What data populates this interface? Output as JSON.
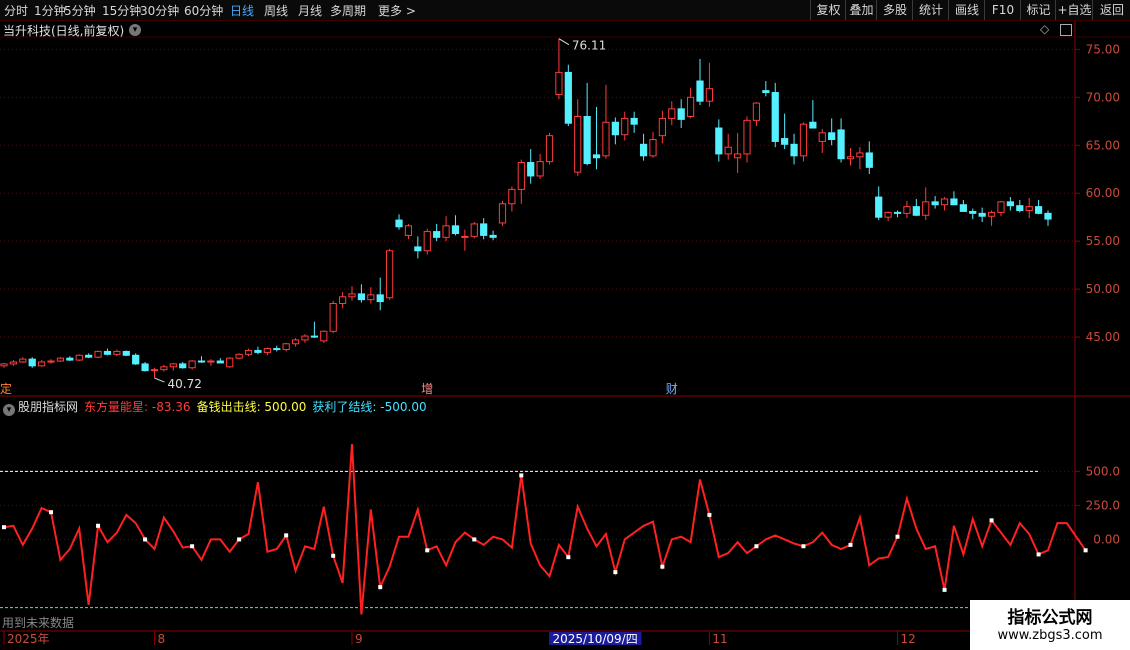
{
  "toolbar": {
    "periods": [
      "分时",
      "1分钟",
      "5分钟",
      "15分钟",
      "30分钟",
      "60分钟",
      "日线",
      "周线",
      "月线",
      "多周期",
      "更多 >"
    ],
    "active_index": 6,
    "right_buttons": [
      "复权",
      "叠加",
      "多股",
      "统计",
      "画线",
      "F10",
      "标记",
      "+自选",
      "返回"
    ]
  },
  "stock": {
    "title": "当升科技(日线,前复权)"
  },
  "indicator": {
    "source": "股朋指标网",
    "legend": [
      {
        "label": "东方量能星: -83.36",
        "color": "#ff3b3b"
      },
      {
        "label": "备钱出击线: 500.00",
        "color": "#ffff40"
      },
      {
        "label": "获利了结线: -500.00",
        "color": "#40e0ff"
      }
    ],
    "note": "用到未来数据"
  },
  "brand": {
    "name": "指标公式网",
    "url": "www.zbgs3.com"
  },
  "colors": {
    "up": "#ff3b3b",
    "down": "#54f0ff",
    "grid": "#6a0000",
    "axis_text": "#c84b3a"
  },
  "chart_data": [
    {
      "type": "candlestick",
      "y_ticks": [
        "45.00",
        "50.00",
        "55.00",
        "60.00",
        "65.00",
        "70.00",
        "75.00"
      ],
      "ylim": [
        40.0,
        76.5
      ],
      "annotations": [
        {
          "text": "76.11",
          "index": 59,
          "value": 76.11
        },
        {
          "text": "40.72",
          "index": 16,
          "value": 40.72
        }
      ],
      "event_markers": [
        {
          "text": "定",
          "index": 0
        },
        {
          "text": "增",
          "index": 45
        },
        {
          "text": "财",
          "index": 71
        }
      ],
      "ohlc": [
        [
          42.0,
          42.3,
          41.8,
          42.2
        ],
        [
          42.2,
          42.6,
          42.0,
          42.4
        ],
        [
          42.4,
          42.9,
          42.3,
          42.7
        ],
        [
          42.7,
          42.9,
          41.8,
          42.0
        ],
        [
          42.0,
          42.6,
          41.9,
          42.4
        ],
        [
          42.4,
          42.7,
          42.2,
          42.5
        ],
        [
          42.5,
          42.9,
          42.4,
          42.8
        ],
        [
          42.8,
          43.0,
          42.5,
          42.6
        ],
        [
          42.6,
          43.2,
          42.5,
          43.1
        ],
        [
          43.1,
          43.3,
          42.8,
          42.9
        ],
        [
          42.9,
          43.6,
          42.8,
          43.5
        ],
        [
          43.5,
          43.8,
          43.1,
          43.2
        ],
        [
          43.2,
          43.7,
          43.0,
          43.5
        ],
        [
          43.5,
          43.6,
          43.0,
          43.1
        ],
        [
          43.1,
          43.3,
          42.1,
          42.2
        ],
        [
          42.2,
          42.4,
          41.4,
          41.5
        ],
        [
          41.5,
          41.8,
          40.72,
          41.6
        ],
        [
          41.6,
          42.1,
          41.4,
          41.9
        ],
        [
          41.9,
          42.3,
          41.5,
          42.2
        ],
        [
          42.2,
          42.4,
          41.7,
          41.8
        ],
        [
          41.8,
          42.6,
          41.6,
          42.5
        ],
        [
          42.5,
          43.0,
          42.3,
          42.4
        ],
        [
          42.4,
          42.7,
          42.0,
          42.5
        ],
        [
          42.5,
          42.8,
          42.3,
          42.3
        ],
        [
          41.9,
          42.9,
          41.8,
          42.8
        ],
        [
          42.8,
          43.3,
          42.7,
          43.2
        ],
        [
          43.2,
          43.8,
          43.0,
          43.6
        ],
        [
          43.6,
          44.0,
          43.2,
          43.4
        ],
        [
          43.4,
          43.9,
          43.1,
          43.8
        ],
        [
          43.8,
          44.1,
          43.5,
          43.7
        ],
        [
          43.7,
          44.4,
          43.5,
          44.3
        ],
        [
          44.3,
          44.9,
          44.0,
          44.7
        ],
        [
          44.7,
          45.3,
          44.4,
          45.1
        ],
        [
          45.1,
          46.6,
          44.9,
          45.0
        ],
        [
          44.6,
          45.7,
          44.4,
          45.6
        ],
        [
          45.6,
          48.8,
          45.4,
          48.5
        ],
        [
          48.5,
          49.7,
          48.0,
          49.2
        ],
        [
          49.2,
          50.3,
          48.8,
          49.5
        ],
        [
          49.5,
          50.5,
          48.6,
          48.9
        ],
        [
          48.9,
          50.2,
          48.5,
          49.4
        ],
        [
          49.4,
          51.2,
          47.8,
          48.7
        ],
        [
          49.1,
          54.2,
          48.9,
          54.0
        ],
        [
          57.2,
          57.8,
          56.2,
          56.5
        ],
        [
          55.6,
          56.8,
          55.2,
          56.6
        ],
        [
          54.4,
          55.5,
          53.2,
          54.0
        ],
        [
          54.0,
          56.3,
          53.6,
          56.0
        ],
        [
          56.0,
          56.8,
          55.0,
          55.4
        ],
        [
          55.4,
          57.6,
          55.0,
          56.6
        ],
        [
          56.6,
          57.7,
          55.6,
          55.8
        ],
        [
          55.4,
          56.2,
          54.0,
          55.5
        ],
        [
          55.5,
          57.0,
          55.3,
          56.8
        ],
        [
          56.8,
          57.4,
          55.2,
          55.6
        ],
        [
          55.6,
          56.1,
          55.1,
          55.4
        ],
        [
          56.9,
          59.2,
          56.6,
          58.9
        ],
        [
          58.9,
          60.7,
          58.1,
          60.4
        ],
        [
          60.4,
          63.5,
          58.9,
          63.2
        ],
        [
          63.2,
          64.6,
          61.0,
          61.8
        ],
        [
          61.8,
          64.1,
          61.5,
          63.3
        ],
        [
          63.3,
          66.3,
          63.0,
          66.0
        ],
        [
          70.3,
          76.11,
          69.8,
          72.6
        ],
        [
          72.6,
          73.4,
          67.0,
          67.3
        ],
        [
          62.2,
          69.8,
          61.8,
          68.0
        ],
        [
          68.0,
          71.5,
          62.9,
          63.1
        ],
        [
          64.0,
          69.0,
          62.5,
          63.7
        ],
        [
          63.9,
          71.3,
          63.6,
          67.4
        ],
        [
          67.4,
          67.9,
          65.1,
          66.1
        ],
        [
          66.1,
          68.5,
          65.5,
          67.8
        ],
        [
          67.8,
          68.5,
          66.3,
          67.2
        ],
        [
          65.1,
          66.2,
          63.4,
          63.9
        ],
        [
          63.9,
          66.4,
          63.7,
          65.6
        ],
        [
          66.0,
          68.6,
          65.2,
          67.8
        ],
        [
          67.8,
          69.6,
          67.1,
          68.8
        ],
        [
          68.8,
          69.8,
          66.8,
          67.7
        ],
        [
          68.0,
          71.0,
          67.8,
          70.0
        ],
        [
          71.7,
          74.0,
          69.2,
          69.6
        ],
        [
          69.6,
          73.6,
          69.0,
          70.9
        ],
        [
          66.8,
          67.7,
          63.3,
          64.1
        ],
        [
          64.1,
          66.2,
          63.5,
          64.8
        ],
        [
          63.7,
          66.3,
          62.1,
          64.1
        ],
        [
          64.1,
          68.0,
          63.2,
          67.6
        ],
        [
          67.6,
          69.5,
          67.0,
          69.4
        ],
        [
          70.7,
          71.7,
          70.1,
          70.5
        ],
        [
          70.5,
          71.5,
          64.8,
          65.4
        ],
        [
          65.7,
          68.3,
          64.6,
          65.1
        ],
        [
          65.1,
          66.2,
          63.0,
          63.9
        ],
        [
          63.9,
          67.4,
          63.3,
          67.2
        ],
        [
          67.4,
          69.7,
          66.8,
          66.8
        ],
        [
          65.4,
          66.7,
          64.2,
          66.3
        ],
        [
          66.3,
          67.8,
          65.0,
          65.6
        ],
        [
          66.6,
          67.8,
          63.2,
          63.6
        ],
        [
          63.6,
          64.7,
          62.9,
          63.8
        ],
        [
          63.8,
          64.8,
          62.5,
          64.2
        ],
        [
          64.2,
          65.4,
          62.0,
          62.7
        ],
        [
          59.6,
          60.7,
          57.2,
          57.5
        ],
        [
          57.5,
          58.1,
          57.1,
          58.0
        ],
        [
          58.0,
          58.2,
          57.5,
          57.9
        ],
        [
          57.9,
          59.2,
          57.4,
          58.6
        ],
        [
          58.6,
          59.4,
          57.6,
          57.7
        ],
        [
          57.7,
          60.6,
          57.2,
          59.1
        ],
        [
          59.1,
          59.7,
          58.4,
          58.8
        ],
        [
          58.8,
          59.6,
          58.2,
          59.4
        ],
        [
          59.4,
          60.2,
          59.0,
          58.8
        ],
        [
          58.8,
          59.3,
          58.2,
          58.1
        ],
        [
          58.1,
          58.4,
          57.3,
          57.9
        ],
        [
          57.9,
          58.5,
          57.0,
          57.6
        ],
        [
          57.6,
          58.2,
          56.6,
          58.0
        ],
        [
          58.0,
          59.2,
          57.6,
          59.1
        ],
        [
          59.1,
          59.6,
          58.2,
          58.7
        ],
        [
          58.7,
          59.3,
          58.0,
          58.2
        ],
        [
          58.2,
          59.5,
          57.4,
          58.6
        ],
        [
          58.6,
          59.3,
          57.8,
          57.9
        ],
        [
          57.9,
          58.2,
          56.6,
          57.3
        ]
      ]
    },
    {
      "type": "line",
      "series": [
        {
          "name": "东方量能星",
          "values": [
            90,
            100,
            -40,
            80,
            230,
            200,
            -150,
            -70,
            80,
            -480,
            100,
            -20,
            50,
            180,
            120,
            0,
            -70,
            160,
            60,
            -60,
            -50,
            -150,
            0,
            0,
            -90,
            0,
            40,
            420,
            -90,
            -70,
            30,
            -230,
            -50,
            -70,
            240,
            -120,
            -320,
            700,
            -550,
            220,
            -350,
            -200,
            20,
            20,
            220,
            -80,
            -50,
            -190,
            -20,
            50,
            0,
            -40,
            20,
            0,
            -60,
            470,
            -30,
            -190,
            -270,
            -40,
            -130,
            240,
            80,
            -50,
            40,
            -240,
            0,
            50,
            100,
            130,
            -200,
            0,
            20,
            -20,
            440,
            180,
            -130,
            -100,
            -20,
            -100,
            -50,
            0,
            30,
            0,
            -30,
            -50,
            -20,
            50,
            -40,
            -70,
            -40,
            160,
            -190,
            -140,
            -130,
            20,
            300,
            80,
            -70,
            -50,
            -370,
            100,
            -110,
            150,
            -50,
            140,
            50,
            -40,
            120,
            40,
            -110,
            -80,
            120,
            120,
            20,
            -80
          ]
        }
      ],
      "reference_lines": [
        {
          "name": "备钱出击线",
          "value": 500.0,
          "color": "#ffffff"
        },
        {
          "name": "获利了结线",
          "value": -500.0,
          "color": "#40e0ff"
        }
      ],
      "y_ticks": [
        "0.00",
        "250.0",
        "500.0"
      ],
      "ylim": [
        -650,
        950
      ],
      "x_labels": [
        {
          "text": "2025年",
          "index": 0
        },
        {
          "text": "8",
          "index": 16
        },
        {
          "text": "9",
          "index": 37
        },
        {
          "text": "2025/10/09/四",
          "index": 58,
          "highlight": true
        },
        {
          "text": "11",
          "index": 75
        },
        {
          "text": "12",
          "index": 95
        }
      ]
    }
  ]
}
